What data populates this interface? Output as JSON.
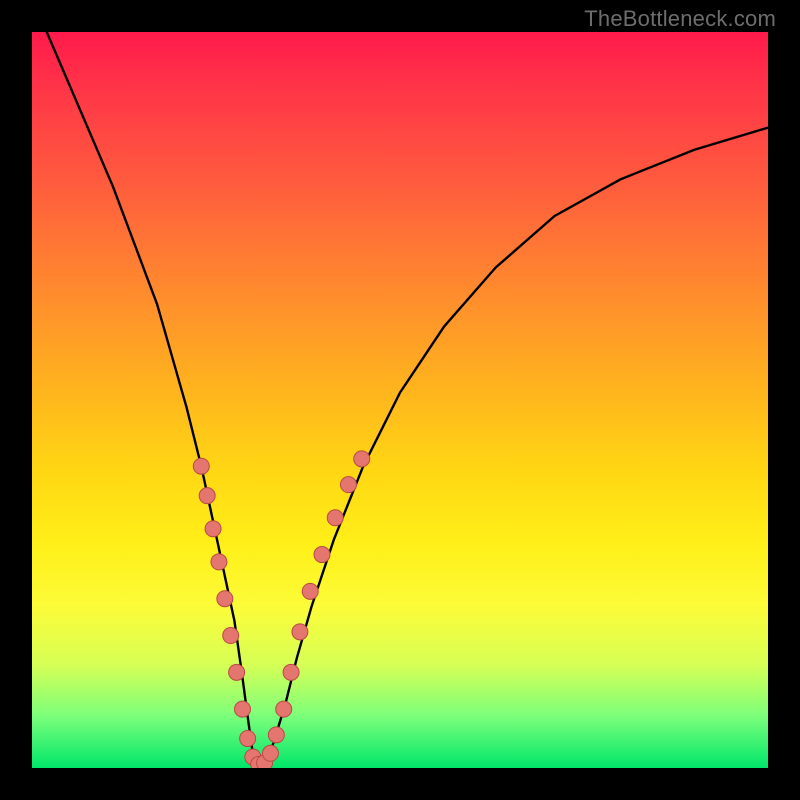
{
  "watermark": "TheBottleneck.com",
  "chart_data": {
    "type": "line",
    "title": "",
    "xlabel": "",
    "ylabel": "",
    "xlim": [
      0,
      100
    ],
    "ylim": [
      0,
      100
    ],
    "series": [
      {
        "name": "curve",
        "x": [
          2,
          5,
          8,
          11,
          14,
          17,
          19,
          21,
          23,
          24.5,
          26,
          27.5,
          28.5,
          29.3,
          30,
          31,
          32,
          33,
          34.5,
          36,
          38,
          41,
          45,
          50,
          56,
          63,
          71,
          80,
          90,
          100
        ],
        "y": [
          100,
          93,
          86,
          79,
          71,
          63,
          56,
          49,
          41,
          34,
          27,
          20,
          13,
          7,
          2,
          0.5,
          1,
          4,
          9,
          15,
          22,
          31,
          41,
          51,
          60,
          68,
          75,
          80,
          84,
          87
        ]
      }
    ],
    "markers": [
      {
        "x": 23.0,
        "y": 41
      },
      {
        "x": 23.8,
        "y": 37
      },
      {
        "x": 24.6,
        "y": 32.5
      },
      {
        "x": 25.4,
        "y": 28
      },
      {
        "x": 26.2,
        "y": 23
      },
      {
        "x": 27.0,
        "y": 18
      },
      {
        "x": 27.8,
        "y": 13
      },
      {
        "x": 28.6,
        "y": 8
      },
      {
        "x": 29.3,
        "y": 4
      },
      {
        "x": 30.0,
        "y": 1.5
      },
      {
        "x": 30.8,
        "y": 0.5
      },
      {
        "x": 31.6,
        "y": 0.7
      },
      {
        "x": 32.4,
        "y": 2
      },
      {
        "x": 33.2,
        "y": 4.5
      },
      {
        "x": 34.2,
        "y": 8
      },
      {
        "x": 35.2,
        "y": 13
      },
      {
        "x": 36.4,
        "y": 18.5
      },
      {
        "x": 37.8,
        "y": 24
      },
      {
        "x": 39.4,
        "y": 29
      },
      {
        "x": 41.2,
        "y": 34
      },
      {
        "x": 43.0,
        "y": 38.5
      },
      {
        "x": 44.8,
        "y": 42
      }
    ],
    "colors": {
      "curve": "#000000",
      "marker_fill": "#e5766f",
      "marker_stroke": "#b84a45"
    }
  }
}
